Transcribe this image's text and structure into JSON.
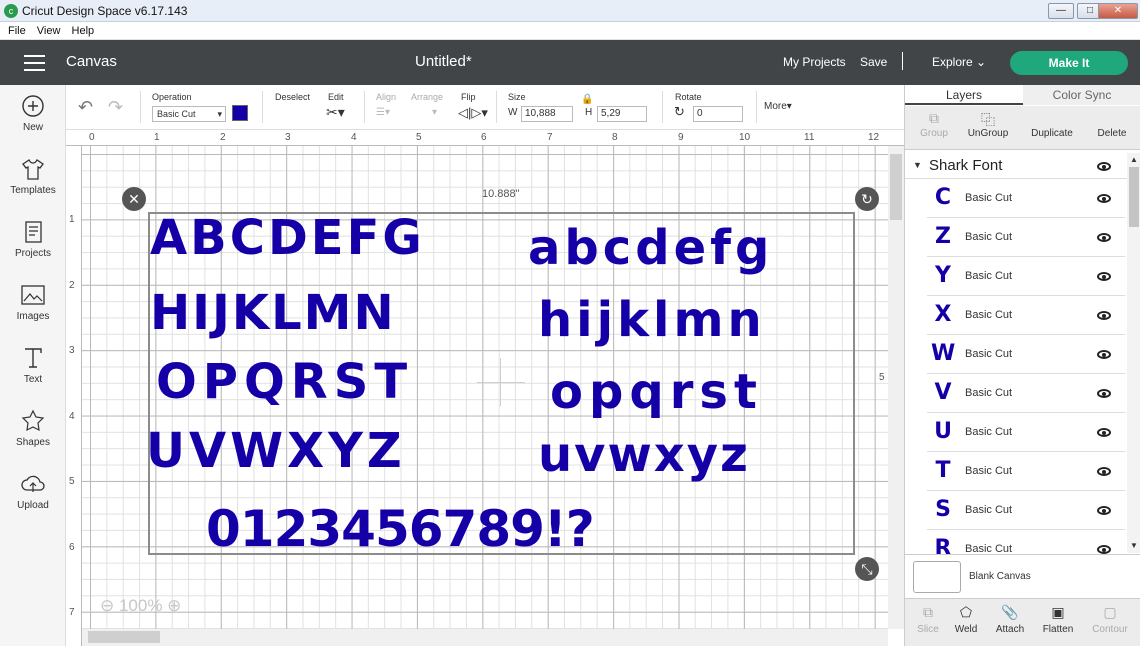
{
  "window": {
    "title": "Cricut Design Space  v6.17.143",
    "min": "—",
    "max": "□",
    "close": "✕"
  },
  "menu": [
    "File",
    "View",
    "Help"
  ],
  "header": {
    "canvas": "Canvas",
    "doc_title": "Untitled*",
    "my_projects": "My Projects",
    "save": "Save",
    "separator": "|",
    "explore": "Explore",
    "make_it": "Make It"
  },
  "sidebar": [
    {
      "label": "New",
      "icon": "plus-circle-icon"
    },
    {
      "label": "Templates",
      "icon": "tshirt-icon"
    },
    {
      "label": "Projects",
      "icon": "projects-icon"
    },
    {
      "label": "Images",
      "icon": "image-icon"
    },
    {
      "label": "Text",
      "icon": "text-icon"
    },
    {
      "label": "Shapes",
      "icon": "shapes-icon"
    },
    {
      "label": "Upload",
      "icon": "upload-cloud-icon"
    }
  ],
  "toolbar": {
    "operation_label": "Operation",
    "operation_value": "Basic Cut",
    "operation_color": "#1500a7",
    "deselect": "Deselect",
    "edit": "Edit",
    "align": "Align",
    "arrange": "Arrange",
    "flip": "Flip",
    "size": "Size",
    "w_label": "W",
    "w_value": "10,888",
    "h_label": "H",
    "h_value": "5,29",
    "rotate": "Rotate",
    "rotate_value": "0",
    "more": "More"
  },
  "rulers": {
    "h": [
      "0",
      "1",
      "2",
      "3",
      "4",
      "5",
      "6",
      "7",
      "8",
      "9",
      "10",
      "11",
      "12"
    ],
    "v": [
      "1",
      "2",
      "3",
      "4",
      "5",
      "6",
      "7"
    ]
  },
  "canvas": {
    "width_label": "10.888\"",
    "right_edge_number": "5",
    "zoom": "100%",
    "rows": [
      "ABCDEFG",
      "abcdefg",
      "HIJKLMN",
      "hijklmn",
      "OPQRST",
      "opqrst",
      "UVWXYZ",
      "uvwxyz",
      "0123456789!?"
    ]
  },
  "panel": {
    "tabs": [
      "Layers",
      "Color Sync"
    ],
    "tools": [
      "Group",
      "UnGroup",
      "Duplicate",
      "Delete"
    ],
    "group_name": "Shark Font",
    "layers": [
      {
        "glyph": "C",
        "name": "Basic Cut"
      },
      {
        "glyph": "Z",
        "name": "Basic Cut"
      },
      {
        "glyph": "Y",
        "name": "Basic Cut"
      },
      {
        "glyph": "X",
        "name": "Basic Cut"
      },
      {
        "glyph": "W",
        "name": "Basic Cut"
      },
      {
        "glyph": "V",
        "name": "Basic Cut"
      },
      {
        "glyph": "U",
        "name": "Basic Cut"
      },
      {
        "glyph": "T",
        "name": "Basic Cut"
      },
      {
        "glyph": "S",
        "name": "Basic Cut"
      },
      {
        "glyph": "R",
        "name": "Basic Cut"
      }
    ],
    "blank_canvas": "Blank Canvas",
    "bottom": [
      "Slice",
      "Weld",
      "Attach",
      "Flatten",
      "Contour"
    ]
  }
}
